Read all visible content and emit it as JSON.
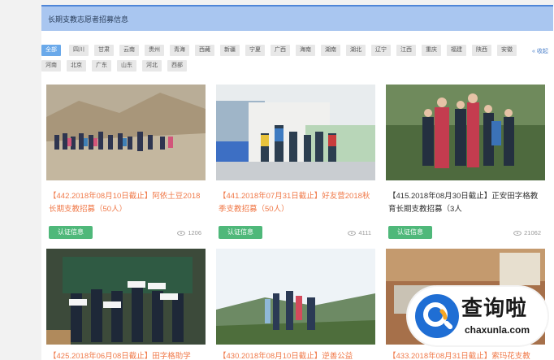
{
  "header": {
    "title": "长期支教志愿者招募信息"
  },
  "filters": {
    "row1": [
      "全部",
      "四川",
      "甘肃",
      "云南",
      "贵州",
      "青海",
      "西藏",
      "新疆",
      "宁夏",
      "广西",
      "海南",
      "湖南",
      "湖北",
      "辽宁",
      "江西",
      "重庆",
      "福建",
      "陕西",
      "安徽"
    ],
    "row2": [
      "河南",
      "北京",
      "广东",
      "山东",
      "河北",
      "西部"
    ],
    "active": "全部",
    "collapse_label": "« 收起"
  },
  "cards": [
    {
      "title": "【442.2018年08月10日截止】阿依土豆2018长期支教招募（50人）",
      "button": "认证信息",
      "views": "1206",
      "title_color": "orange"
    },
    {
      "title": "【441.2018年07月31日截止】好友营2018秋季支教招募（50人）",
      "button": "认证信息",
      "views": "4111",
      "title_color": "orange"
    },
    {
      "title": "【415.2018年08月30日截止】正安田字格教育长期支教招募（3人",
      "button": "认证信息",
      "views": "21062",
      "title_color": "dark"
    },
    {
      "title": "【425.2018年06月08日截止】田字格助学",
      "title_color": "orange"
    },
    {
      "title": "【430.2018年08月10日截止】逆善公益",
      "title_color": "orange"
    },
    {
      "title": "【433.2018年08月31日截止】索玛花支教",
      "title_color": "orange"
    }
  ],
  "watermark": {
    "text": "查询啦",
    "sub": "chaxunla.com"
  }
}
